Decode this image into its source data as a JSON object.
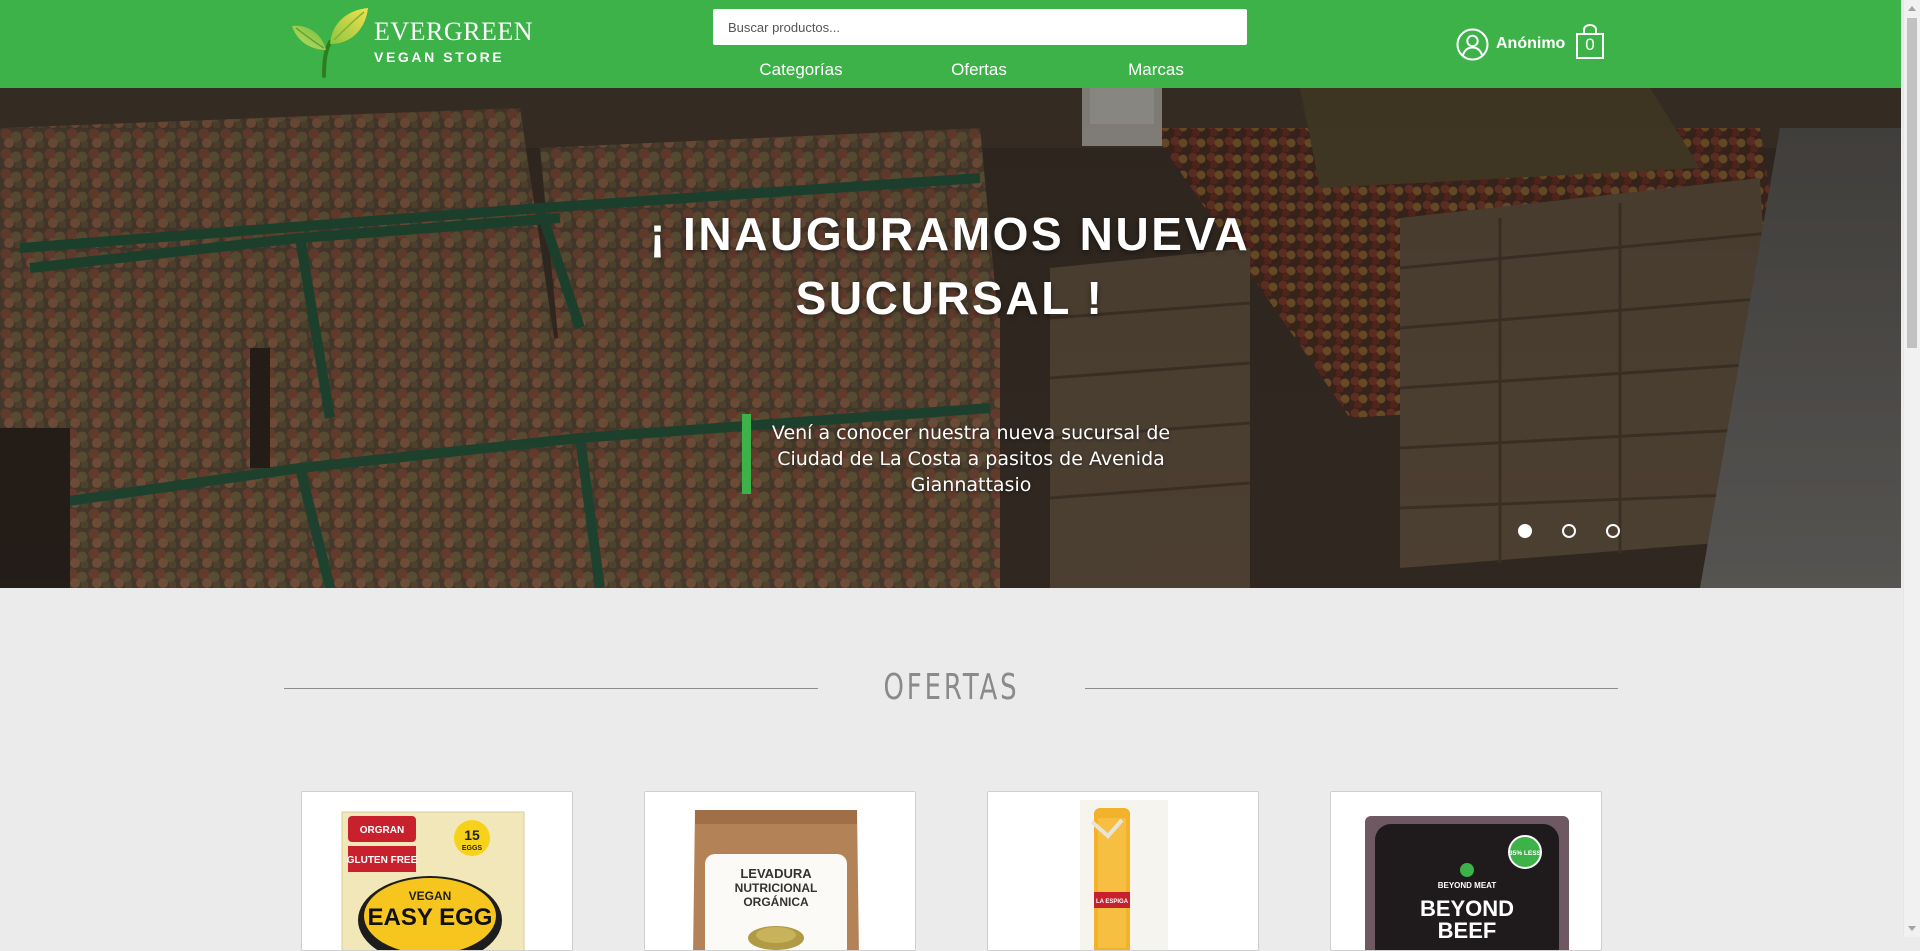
{
  "header": {
    "logo_title": "EVERGREEN",
    "logo_subtitle": "VEGAN STORE",
    "search_placeholder": "Buscar productos...",
    "nav": [
      "Categorías",
      "Ofertas",
      "Marcas"
    ],
    "user_label": "Anónimo",
    "cart_count": "0",
    "colors": {
      "brand_green": "#3db249",
      "text": "#ffffff"
    },
    "icons": {
      "logo": "leaf-sprout-icon",
      "user": "user-circle-icon",
      "cart": "shopping-bag-icon"
    }
  },
  "hero": {
    "title": "¡ INAUGURAMOS NUEVA SUCURSAL !",
    "subtitle": "Vení a conocer nuestra nueva sucursal de Ciudad de La Costa a pasitos de Avenida Giannattasio",
    "slides_total": 3,
    "active_slide": 1
  },
  "offers": {
    "section_title": "OFERTAS",
    "products": [
      {
        "package_brand": "ORGRAN",
        "package_badge_top": "GLUTEN FREE",
        "package_count": "15",
        "package_count_unit": "EGGS",
        "package_line1": "VEGAN",
        "package_line2": "EASY EGG"
      },
      {
        "package_line1": "LEVADURA",
        "package_line2": "NUTRICIONAL",
        "package_line3": "ORGÁNICA"
      },
      {
        "package_label": "LA ESPIGA"
      },
      {
        "package_brand": "BEYOND MEAT",
        "package_badge": "35% LESS",
        "package_line1": "BEYOND",
        "package_line2": "BEEF"
      }
    ]
  }
}
